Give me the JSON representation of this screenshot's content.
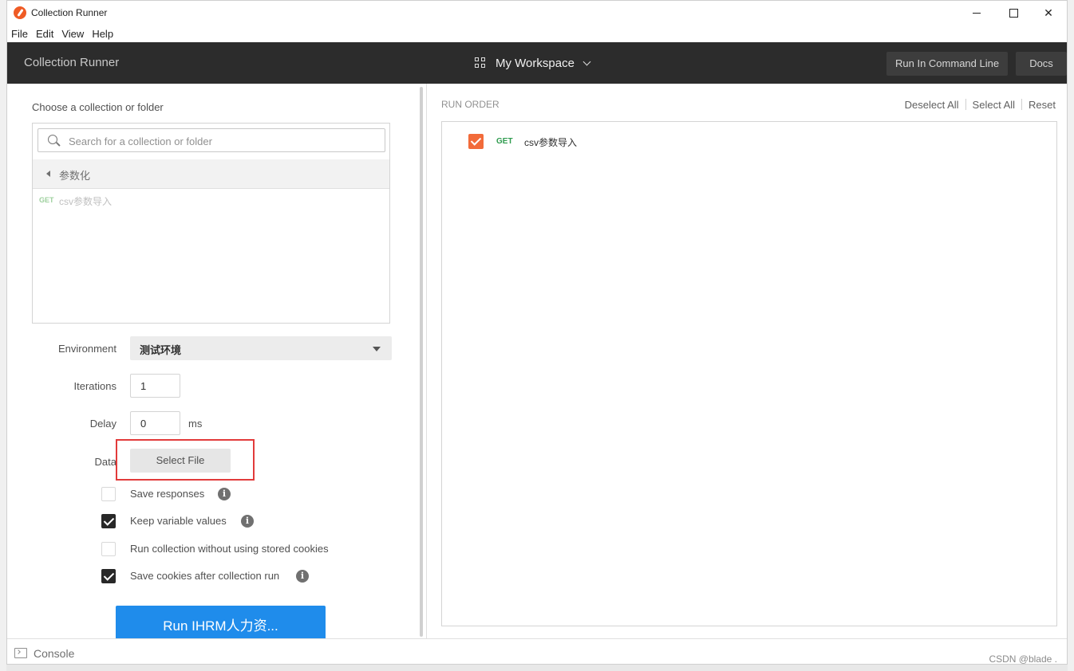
{
  "window": {
    "title": "Collection Runner"
  },
  "menu": [
    "File",
    "Edit",
    "View",
    "Help"
  ],
  "header": {
    "title": "Collection Runner",
    "workspace": "My Workspace",
    "run_cli_label": "Run In Command Line",
    "docs_label": "Docs"
  },
  "left": {
    "choose_label": "Choose a collection or folder",
    "search_placeholder": "Search for a collection or folder",
    "folder_name": "参数化",
    "request": {
      "method": "GET",
      "name": "csv参数导入"
    },
    "environment_label": "Environment",
    "environment_value": "测试环境",
    "iterations_label": "Iterations",
    "iterations_value": "1",
    "delay_label": "Delay",
    "delay_value": "0",
    "delay_unit": "ms",
    "data_label": "Data",
    "select_file_label": "Select File",
    "options": [
      {
        "label": "Save responses",
        "checked": false,
        "info": true
      },
      {
        "label": "Keep variable values",
        "checked": true,
        "info": true
      },
      {
        "label": "Run collection without using stored cookies",
        "checked": false,
        "info": false
      },
      {
        "label": "Save cookies after collection run",
        "checked": true,
        "info": true
      }
    ],
    "run_button_label": "Run IHRM人力资..."
  },
  "right": {
    "run_order_label": "RUN ORDER",
    "deselect_all": "Deselect All",
    "select_all": "Select All",
    "reset": "Reset",
    "order_item": {
      "method": "GET",
      "name": "csv参数导入",
      "checked": true
    }
  },
  "footer": {
    "console_label": "Console",
    "watermark": "CSDN @blade ."
  },
  "colors": {
    "header_bg": "#2c2c2c",
    "run_button": "#1f8ceb",
    "accent_orange": "#f26b3a",
    "get_green": "#2e9b4e",
    "highlight_red": "#e23b3b"
  }
}
